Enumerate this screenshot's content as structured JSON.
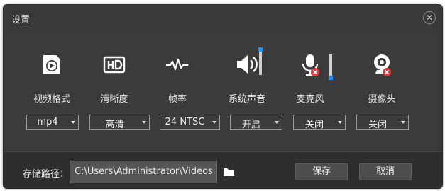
{
  "dialog": {
    "title": "设置"
  },
  "options": [
    {
      "id": "video-format",
      "label": "视频格式",
      "value": "mp4",
      "icon": "play-video-icon"
    },
    {
      "id": "resolution",
      "label": "清晰度",
      "value": "高清",
      "icon": "hd-icon"
    },
    {
      "id": "frame-rate",
      "label": "帧率",
      "value": "24 NTSC",
      "icon": "waveform-icon"
    },
    {
      "id": "system-audio",
      "label": "系统声音",
      "value": "开启",
      "icon": "speaker-icon"
    },
    {
      "id": "microphone",
      "label": "麦克风",
      "value": "关闭",
      "icon": "microphone-muted-icon"
    },
    {
      "id": "camera",
      "label": "摄像头",
      "value": "关闭",
      "icon": "webcam-off-icon"
    }
  ],
  "footer": {
    "path_label": "存储路径：",
    "path_value": "C:\\Users\\Administrator\\Videos",
    "save_label": "保存",
    "cancel_label": "取消"
  },
  "colors": {
    "accent": "#1e90ff",
    "mute_badge": "#e03a3a",
    "background": "#3b3b3b"
  }
}
